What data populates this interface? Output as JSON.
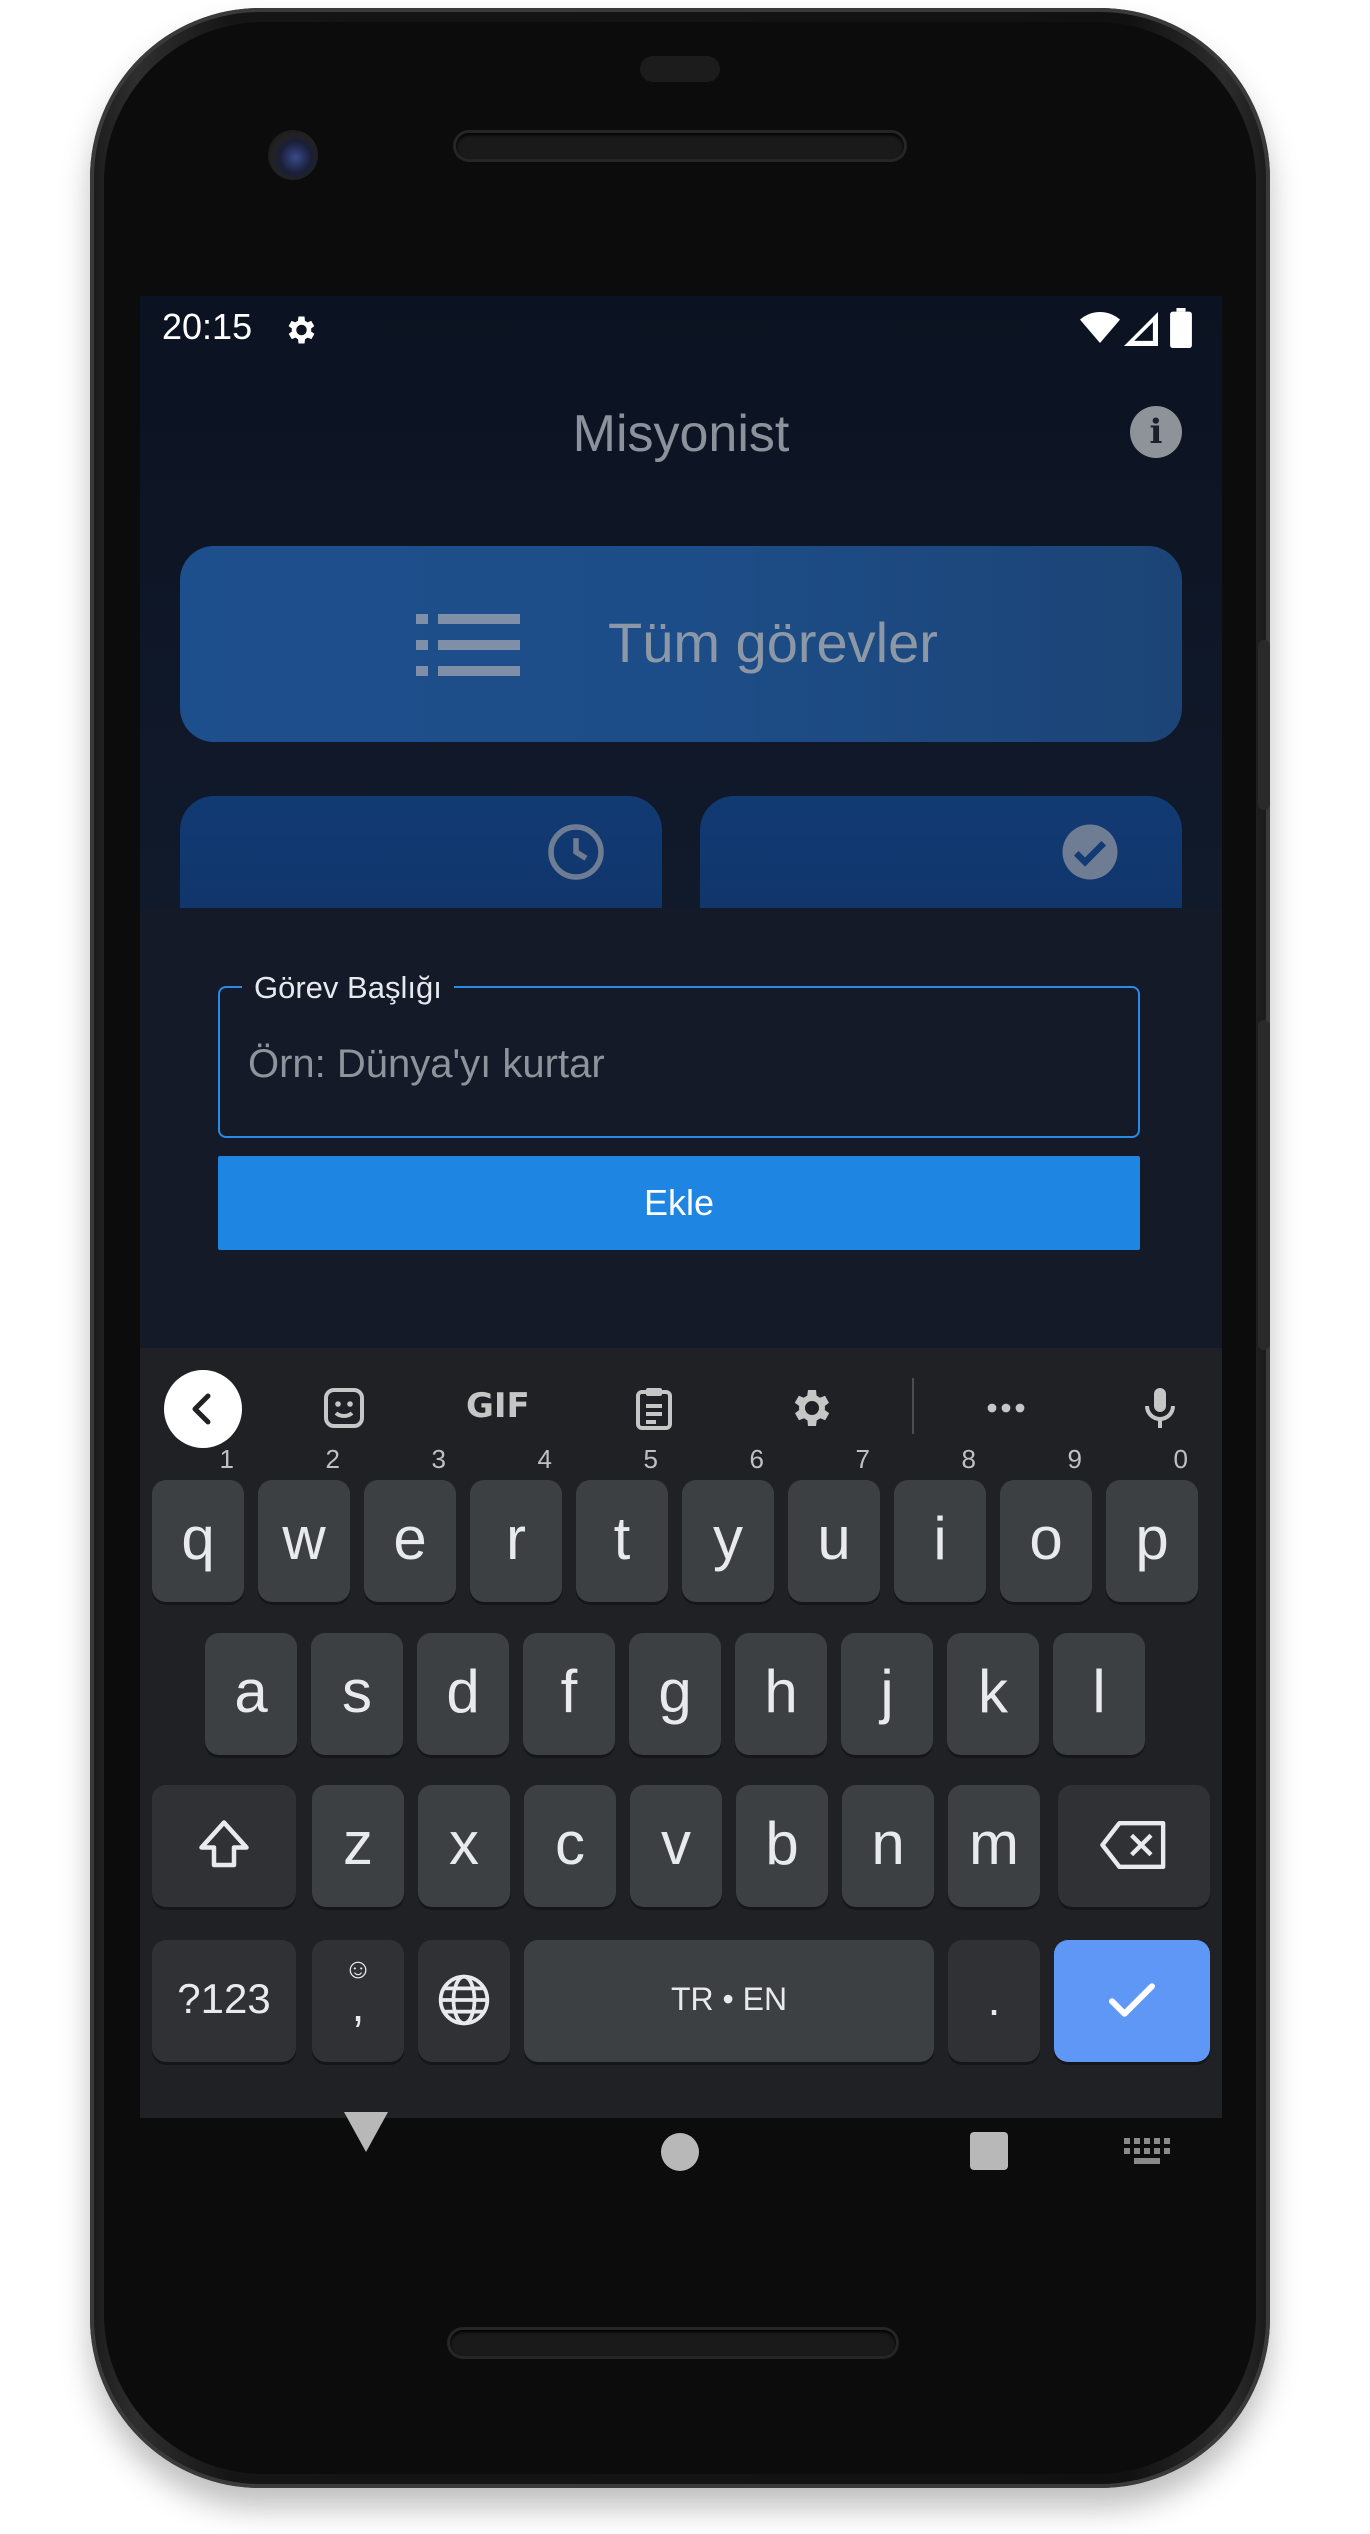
{
  "status_bar": {
    "time": "20:15",
    "icons": [
      "gear-icon",
      "wifi-icon",
      "signal-icon",
      "battery-icon"
    ]
  },
  "app": {
    "title": "Misyonist",
    "all_tasks_label": "Tüm görevler",
    "card_left_icon": "clock-icon",
    "card_right_icon": "check-circle-icon"
  },
  "sheet": {
    "field_label": "Görev Başlığı",
    "field_placeholder": "Örn: Dünya'yı kurtar",
    "field_value": "",
    "add_button": "Ekle"
  },
  "keyboard": {
    "toolbar": [
      "back-icon",
      "sticker-icon",
      "gif-icon",
      "clipboard-icon",
      "settings-icon",
      "more-icon",
      "mic-icon"
    ],
    "gif_label": "GIF",
    "row1": [
      {
        "k": "q",
        "h": "1"
      },
      {
        "k": "w",
        "h": "2"
      },
      {
        "k": "e",
        "h": "3"
      },
      {
        "k": "r",
        "h": "4"
      },
      {
        "k": "t",
        "h": "5"
      },
      {
        "k": "y",
        "h": "6"
      },
      {
        "k": "u",
        "h": "7"
      },
      {
        "k": "i",
        "h": "8"
      },
      {
        "k": "o",
        "h": "9"
      },
      {
        "k": "p",
        "h": "0"
      }
    ],
    "row2": [
      "a",
      "s",
      "d",
      "f",
      "g",
      "h",
      "j",
      "k",
      "l"
    ],
    "row3": [
      "z",
      "x",
      "c",
      "v",
      "b",
      "n",
      "m"
    ],
    "symbols_key": "?123",
    "comma_key": ",",
    "space_key": "TR • EN",
    "period_key": "."
  },
  "colors": {
    "accent": "#1e85e3",
    "enter_key": "#5e97f6",
    "sheet_bg": "#141a28"
  }
}
